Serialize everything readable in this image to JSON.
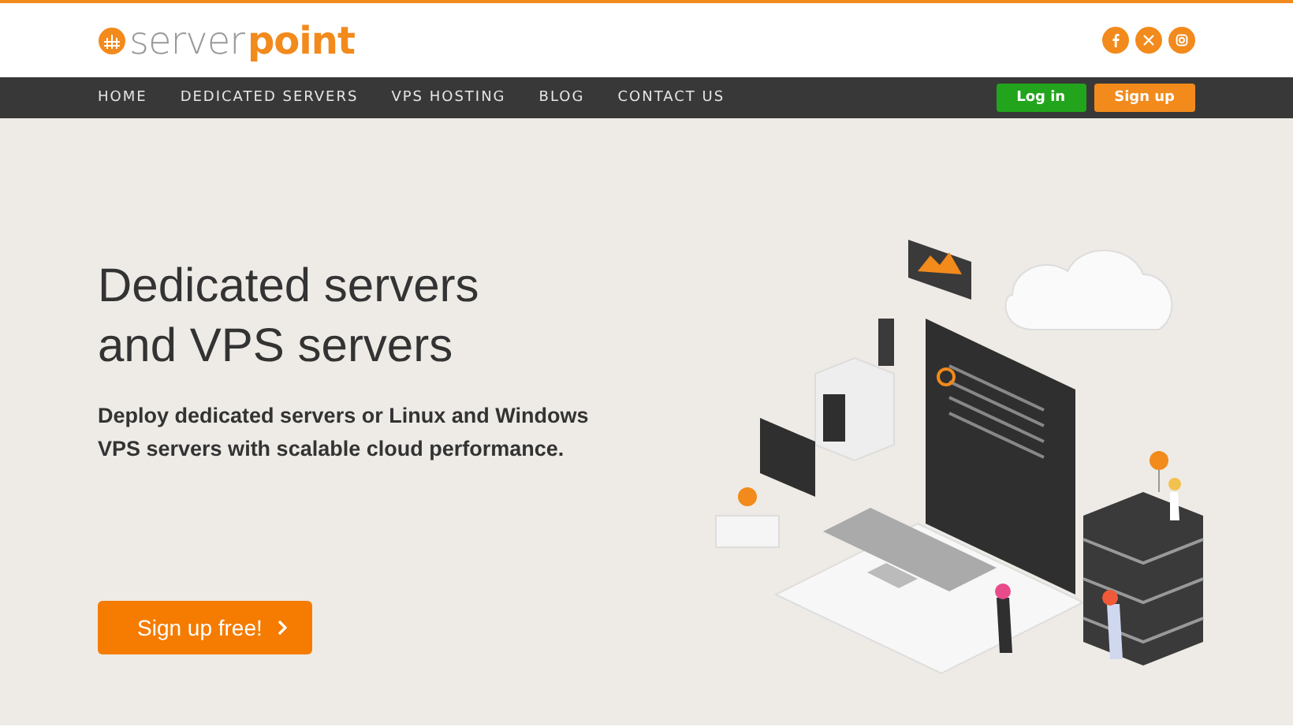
{
  "logo": {
    "text_light": "server",
    "text_accent": "point"
  },
  "social_links": [
    {
      "kind": "facebook"
    },
    {
      "kind": "x"
    },
    {
      "kind": "instagram"
    }
  ],
  "nav": {
    "items": [
      {
        "label": "HOME"
      },
      {
        "label": "DEDICATED SERVERS"
      },
      {
        "label": "VPS HOSTING"
      },
      {
        "label": "BLOG"
      },
      {
        "label": "CONTACT US"
      }
    ],
    "buttons": [
      {
        "label": "Log in",
        "kind": "login"
      },
      {
        "label": "Sign up",
        "kind": "signup"
      }
    ]
  },
  "hero": {
    "title_lines": [
      "Dedicated servers",
      "and VPS servers"
    ],
    "subtitle": "Deploy dedicated servers or Linux and Windows VPS servers with scalable cloud performance.",
    "cta": "Sign up free!"
  }
}
